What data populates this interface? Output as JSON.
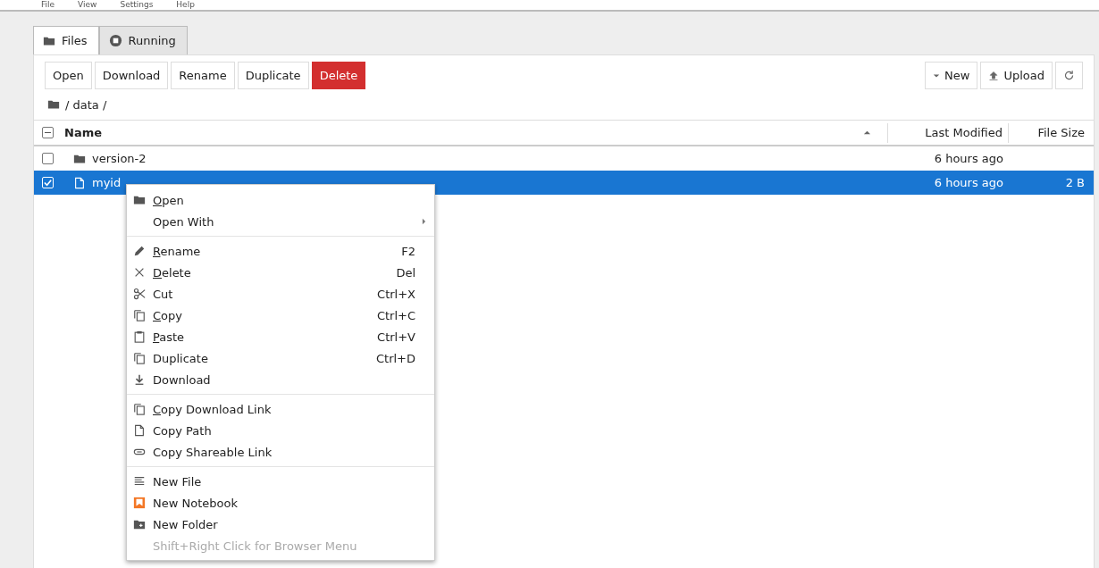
{
  "menu_bar": [
    "File",
    "View",
    "Settings",
    "Help"
  ],
  "tabs": [
    {
      "label": "Files",
      "selected": true
    },
    {
      "label": "Running",
      "selected": false
    }
  ],
  "toolbar": {
    "left": [
      {
        "label": "Open",
        "kind": "plain"
      },
      {
        "label": "Download",
        "kind": "plain"
      },
      {
        "label": "Rename",
        "kind": "plain"
      },
      {
        "label": "Duplicate",
        "kind": "plain"
      },
      {
        "label": "Delete",
        "kind": "danger"
      }
    ],
    "right": [
      {
        "label": "New"
      },
      {
        "label": "Upload"
      }
    ]
  },
  "breadcrumb": "/ data /",
  "table": {
    "select_all_partial": true,
    "columns": [
      "Name",
      "Last Modified",
      "File Size"
    ],
    "rows": [
      {
        "name": "version-2",
        "kind": "folder",
        "modified": "6 hours ago",
        "selected": false
      },
      {
        "name": "myid",
        "kind": "file",
        "modified": "6 hours ago",
        "size": "2 B",
        "selected": true
      }
    ]
  },
  "context_menu": {
    "groups": [
      [
        {
          "label": "Open",
          "mnemonic": true,
          "submenu": false
        },
        {
          "label": "Open With",
          "mnemonic": false,
          "submenu": true
        }
      ],
      [
        {
          "label": "Rename",
          "mnemonic": true,
          "shortcut": "F2"
        },
        {
          "label": "Delete",
          "mnemonic": true,
          "shortcut": "Del"
        },
        {
          "label": "Cut",
          "mnemonic": false,
          "shortcut": "Ctrl+X"
        },
        {
          "label": "Copy",
          "mnemonic": true,
          "shortcut": "Ctrl+C"
        },
        {
          "label": "Paste",
          "mnemonic": true,
          "shortcut": "Ctrl+V"
        },
        {
          "label": "Duplicate",
          "mnemonic": false,
          "shortcut": "Ctrl+D"
        },
        {
          "label": "Download",
          "mnemonic": false
        }
      ],
      [
        {
          "label": "Copy Download Link",
          "mnemonic": true
        },
        {
          "label": "Copy Path",
          "mnemonic": false
        },
        {
          "label": "Copy Shareable Link",
          "mnemonic": false
        }
      ],
      [
        {
          "label": "New File",
          "mnemonic": false,
          "disabled": false
        },
        {
          "label": "New Notebook",
          "mnemonic": false,
          "disabled": false
        },
        {
          "label": "New Folder",
          "mnemonic": false,
          "disabled": false
        },
        {
          "label": "Shift+Right Click for Browser Menu",
          "mnemonic": false,
          "disabled": true
        }
      ]
    ]
  }
}
